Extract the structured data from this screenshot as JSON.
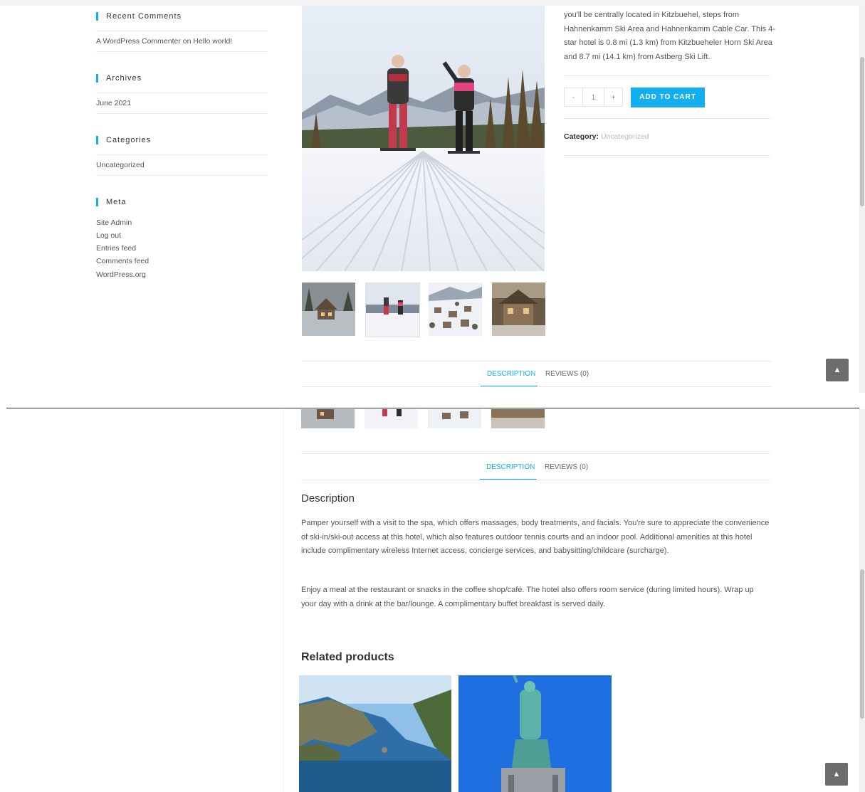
{
  "sidebar": {
    "recent_comments": {
      "title": "Recent Comments",
      "items": [
        {
          "author": "A WordPress Commenter",
          "on_text": " on ",
          "post": "Hello world!"
        }
      ]
    },
    "archives": {
      "title": "Archives",
      "items": [
        "June 2021"
      ]
    },
    "categories": {
      "title": "Categories",
      "items": [
        "Uncategorized"
      ]
    },
    "meta": {
      "title": "Meta",
      "items": [
        "Site Admin",
        "Log out",
        "Entries feed",
        "Comments feed",
        "WordPress.org"
      ]
    }
  },
  "product": {
    "short_description": "you'll be centrally located in Kitzbuehel, steps from Hahnenkamm Ski Area and Hahnenkamm Cable Car. This 4-star hotel is 0.8 mi (1.3 km) from Kitzbueheler Horn Ski Area and 8.7 mi (14.1 km) from Astberg Ski Lift.",
    "quantity": {
      "minus": "-",
      "value": "1",
      "plus": "+"
    },
    "add_to_cart": "ADD TO CART",
    "category_label": "Category:",
    "category_value": "Uncategorized"
  },
  "tabs": [
    {
      "label": "DESCRIPTION",
      "active": true
    },
    {
      "label": "REVIEWS (0)",
      "active": false
    }
  ],
  "description": {
    "heading": "Description",
    "paragraphs": [
      "Pamper yourself with a visit to the spa, which offers massages, body treatments, and facials. You're sure to appreciate the convenience of ski-in/ski-out access at this hotel, which also features outdoor tennis courts and an indoor pool. Additional amenities at this hotel include complimentary wireless Internet access, concierge services, and babysitting/childcare (surcharge).",
      "Enjoy a meal at the restaurant or snacks in the coffee shop/café. The hotel also offers room service (during limited hours). Wrap up your day with a drink at the bar/lounge. A complimentary buffet breakfast is served daily."
    ]
  },
  "related": {
    "heading": "Related products"
  },
  "colors": {
    "accent": "#13aff0",
    "scrolltop_bg": "#6d6d6d"
  },
  "icons": {
    "scroll_top": "chevron-up-icon"
  }
}
